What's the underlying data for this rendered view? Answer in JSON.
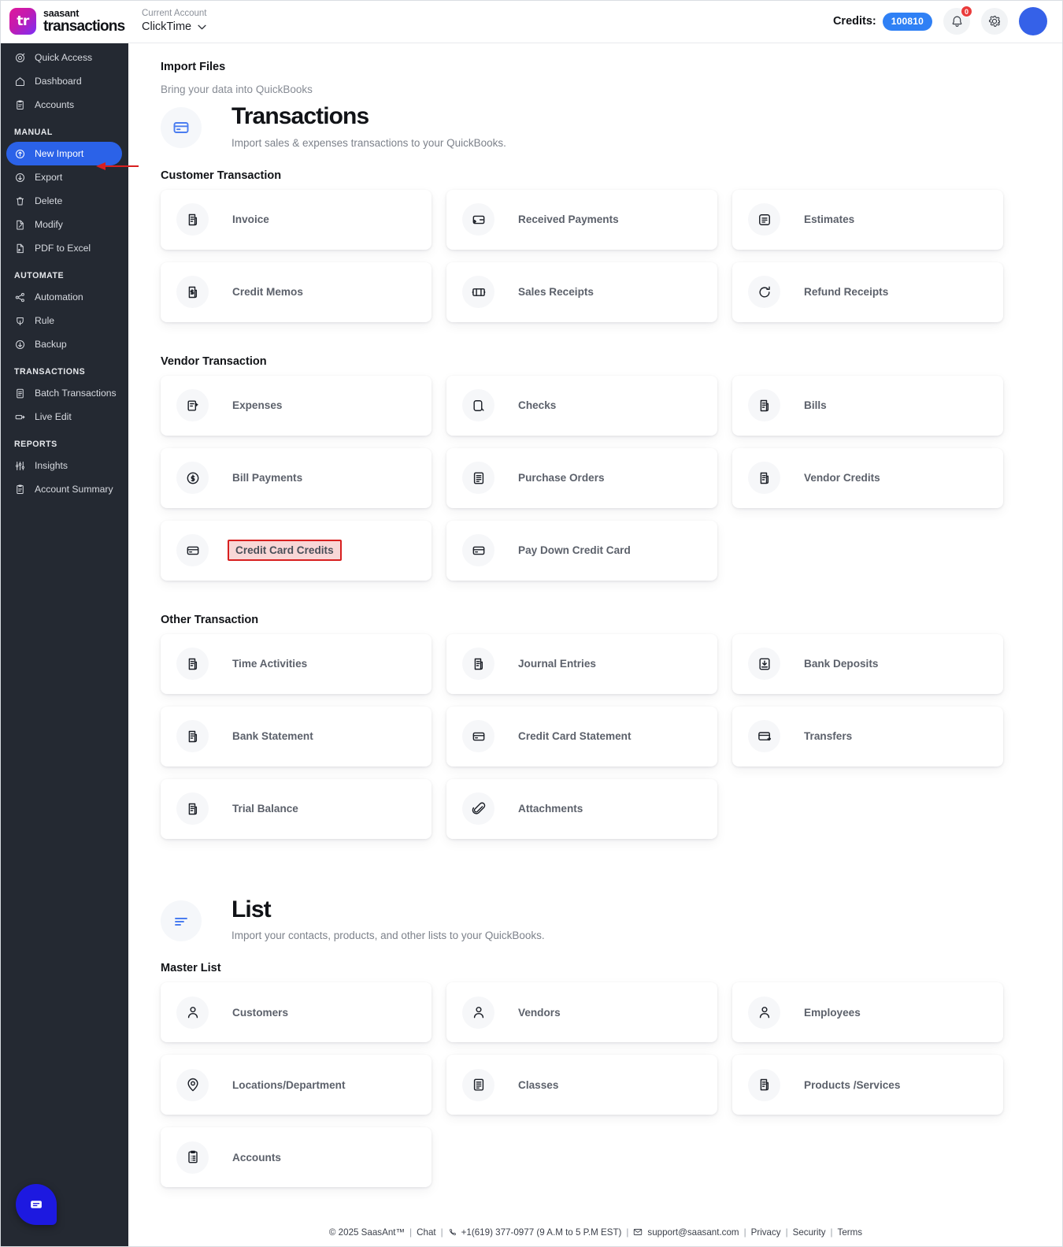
{
  "topbar": {
    "logo_mark": "tr",
    "brand_line1": "saasant",
    "brand_line2": "transactions",
    "account_label": "Current Account",
    "account_name": "ClickTime",
    "credits_label": "Credits:",
    "credits_value": "100810",
    "notification_count": "0",
    "accent_blue": "#2f80f5",
    "avatar_color": "#3561e8"
  },
  "sidebar": {
    "items": [
      {
        "label": "Quick Access",
        "icon": "target-icon",
        "active": false
      },
      {
        "label": "Dashboard",
        "icon": "home-icon",
        "active": false
      },
      {
        "label": "Accounts",
        "icon": "clipboard-icon",
        "active": false
      }
    ],
    "groups": [
      {
        "title": "MANUAL",
        "items": [
          {
            "label": "New Import",
            "icon": "upload-icon",
            "active": true
          },
          {
            "label": "Export",
            "icon": "download-icon",
            "active": false
          },
          {
            "label": "Delete",
            "icon": "trash-icon",
            "active": false
          },
          {
            "label": "Modify",
            "icon": "edit-doc-icon",
            "active": false
          },
          {
            "label": "PDF to Excel",
            "icon": "pdf-file-icon",
            "active": false
          }
        ]
      },
      {
        "title": "AUTOMATE",
        "items": [
          {
            "label": "Automation",
            "icon": "share-nodes-icon",
            "active": false
          },
          {
            "label": "Rule",
            "icon": "rule-icon",
            "active": false
          },
          {
            "label": "Backup",
            "icon": "backup-icon",
            "active": false
          }
        ]
      },
      {
        "title": "TRANSACTIONS",
        "items": [
          {
            "label": "Batch Transactions",
            "icon": "document-icon",
            "active": false
          },
          {
            "label": "Live Edit",
            "icon": "live-edit-icon",
            "active": false
          }
        ]
      },
      {
        "title": "REPORTS",
        "items": [
          {
            "label": "Insights",
            "icon": "sliders-icon",
            "active": false
          },
          {
            "label": "Account Summary",
            "icon": "clipboard-icon",
            "active": false
          }
        ]
      }
    ]
  },
  "main": {
    "page_title": "Import Files",
    "page_subtitle": "Bring your data into QuickBooks",
    "sections": [
      {
        "id": "transactions",
        "icon": "credit-card-icon",
        "title": "Transactions",
        "desc": "Import sales & expenses transactions to your QuickBooks.",
        "groups": [
          {
            "title": "Customer Transaction",
            "cards": [
              {
                "label": "Invoice",
                "icon": "invoice-icon",
                "highlight": false
              },
              {
                "label": "Received Payments",
                "icon": "received-payment-icon",
                "highlight": false
              },
              {
                "label": "Estimates",
                "icon": "estimate-icon",
                "highlight": false
              },
              {
                "label": "Credit Memos",
                "icon": "credit-memo-icon",
                "highlight": false
              },
              {
                "label": "Sales Receipts",
                "icon": "sales-receipt-icon",
                "highlight": false
              },
              {
                "label": "Refund Receipts",
                "icon": "refund-icon",
                "highlight": false
              }
            ]
          },
          {
            "title": "Vendor Transaction",
            "cards": [
              {
                "label": "Expenses",
                "icon": "expense-icon",
                "highlight": false
              },
              {
                "label": "Checks",
                "icon": "check-icon",
                "highlight": false
              },
              {
                "label": "Bills",
                "icon": "bill-icon",
                "highlight": false
              },
              {
                "label": "Bill Payments",
                "icon": "dollar-coin-icon",
                "highlight": false
              },
              {
                "label": "Purchase Orders",
                "icon": "purchase-order-icon",
                "highlight": false
              },
              {
                "label": "Vendor Credits",
                "icon": "vendor-credit-icon",
                "highlight": false
              },
              {
                "label": "Credit Card Credits",
                "icon": "card-icon",
                "highlight": true
              },
              {
                "label": "Pay Down Credit Card",
                "icon": "card-icon",
                "highlight": false
              },
              {
                "label": "",
                "icon": "",
                "empty": true
              }
            ]
          },
          {
            "title": "Other Transaction",
            "cards": [
              {
                "label": "Time Activities",
                "icon": "clipboard-icon",
                "highlight": false
              },
              {
                "label": "Journal Entries",
                "icon": "clipboard-icon",
                "highlight": false
              },
              {
                "label": "Bank Deposits",
                "icon": "deposit-icon",
                "highlight": false
              },
              {
                "label": "Bank Statement",
                "icon": "clipboard-icon",
                "highlight": false
              },
              {
                "label": "Credit Card Statement",
                "icon": "card-icon",
                "highlight": false
              },
              {
                "label": "Transfers",
                "icon": "transfer-icon",
                "highlight": false
              },
              {
                "label": "Trial Balance",
                "icon": "clipboard-icon",
                "highlight": false
              },
              {
                "label": "Attachments",
                "icon": "paperclip-icon",
                "highlight": false
              },
              {
                "label": "",
                "icon": "",
                "empty": true
              }
            ]
          }
        ]
      },
      {
        "id": "list",
        "icon": "list-icon",
        "title": "List",
        "desc": "Import your contacts, products, and other lists to your QuickBooks.",
        "groups": [
          {
            "title": "Master List",
            "cards": [
              {
                "label": "Customers",
                "icon": "person-icon",
                "highlight": false
              },
              {
                "label": "Vendors",
                "icon": "person-icon",
                "highlight": false
              },
              {
                "label": "Employees",
                "icon": "person-icon",
                "highlight": false
              },
              {
                "label": "Locations/Department",
                "icon": "pin-icon",
                "highlight": false
              },
              {
                "label": "Classes",
                "icon": "purchase-order-icon",
                "highlight": false
              },
              {
                "label": "Products /Services",
                "icon": "clipboard-icon",
                "highlight": false
              },
              {
                "label": "Accounts",
                "icon": "accounts-icon",
                "highlight": false
              },
              {
                "label": "",
                "icon": "",
                "empty": true
              },
              {
                "label": "",
                "icon": "",
                "empty": true
              }
            ]
          }
        ]
      }
    ]
  },
  "footer": {
    "copyright": "© 2025 SaasAnt™",
    "chat": "Chat",
    "phone": "+1(619) 377-0977 (9 A.M to 5 P.M EST)",
    "email": "support@saasant.com",
    "privacy": "Privacy",
    "security": "Security",
    "terms": "Terms"
  },
  "chat_widget": {
    "icon": "chat-bubble-icon",
    "color": "#1d19e0"
  },
  "annotation": {
    "arrow_color": "#d82020",
    "highlight_border": "#d82020",
    "highlight_fill": "#f8d7d7"
  }
}
